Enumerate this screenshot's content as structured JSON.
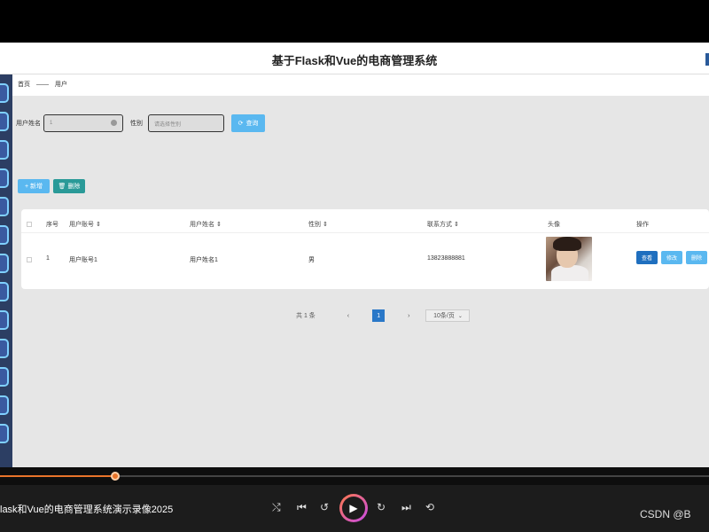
{
  "app": {
    "title": "基于Flask和Vue的电商管理系统"
  },
  "breadcrumb": {
    "home": "首页",
    "current": "用户"
  },
  "search": {
    "username_label": "用户姓名",
    "username_value": "1",
    "gender_label": "性别",
    "gender_placeholder": "请选择性别",
    "query_label": "查询"
  },
  "actions": {
    "add_label": "新增",
    "delete_label": "删除"
  },
  "table": {
    "headers": [
      "序号",
      "用户账号",
      "用户姓名",
      "性别",
      "联系方式",
      "头像",
      "操作"
    ],
    "rows": [
      {
        "index": "1",
        "account": "用户账号1",
        "name": "用户姓名1",
        "gender": "男",
        "phone": "13823888881",
        "view": "查看",
        "edit": "修改",
        "delete": "删除"
      }
    ]
  },
  "pagination": {
    "total": "共 1 条",
    "prev": "‹",
    "current": "1",
    "next": "›",
    "page_size": "10条/页"
  },
  "player": {
    "video_title": "lask和Vue的电商管理系统演示录像2025",
    "progress_fraction": 0.162,
    "watermark": "CSDN @B",
    "accent_color": "#e8742a"
  }
}
